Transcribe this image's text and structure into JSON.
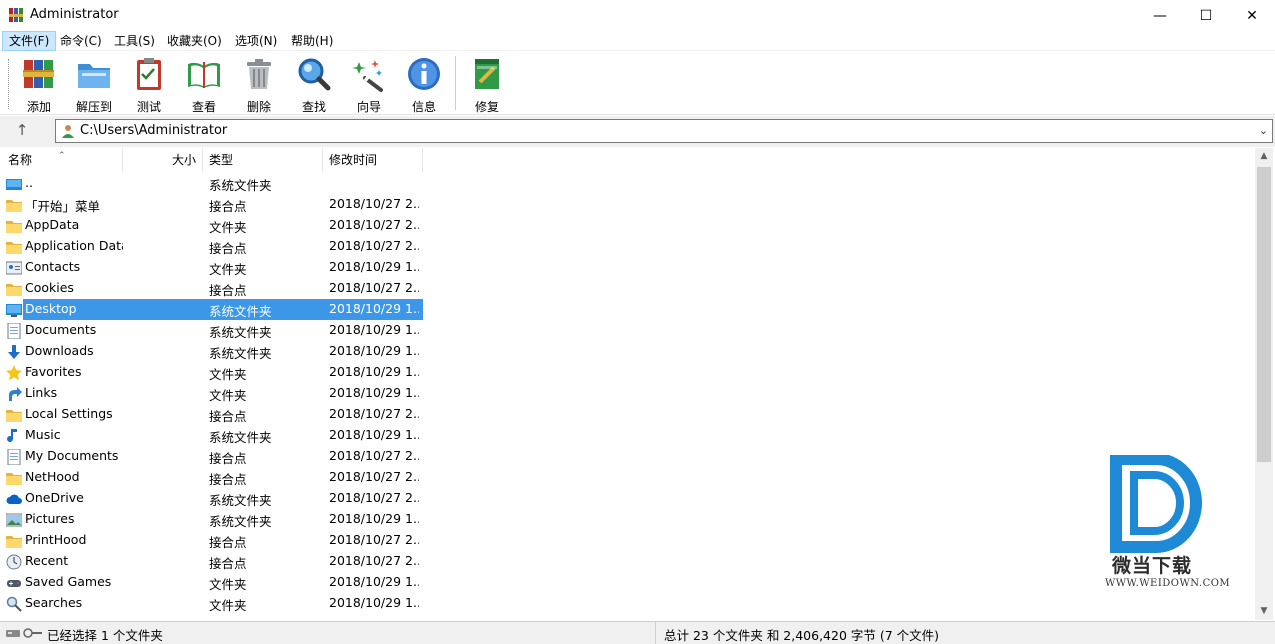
{
  "window": {
    "title": "Administrator",
    "min_glyph": "—",
    "max_glyph": "☐",
    "close_glyph": "✕"
  },
  "menu": [
    {
      "label": "文件(F)",
      "active": true
    },
    {
      "label": "命令(C)"
    },
    {
      "label": "工具(S)"
    },
    {
      "label": "收藏夹(O)"
    },
    {
      "label": "选项(N)"
    },
    {
      "label": "帮助(H)"
    }
  ],
  "toolbar": [
    {
      "label": "添加",
      "icon": "books-add-icon"
    },
    {
      "label": "解压到",
      "icon": "folder-extract-icon"
    },
    {
      "label": "测试",
      "icon": "clipboard-test-icon"
    },
    {
      "label": "查看",
      "icon": "open-book-view-icon"
    },
    {
      "label": "删除",
      "icon": "trash-icon"
    },
    {
      "label": "查找",
      "icon": "magnifier-icon"
    },
    {
      "label": "向导",
      "icon": "magic-wand-icon"
    },
    {
      "label": "信息",
      "icon": "info-icon"
    },
    {
      "label": "修复",
      "icon": "repair-kit-icon"
    }
  ],
  "address": {
    "up_glyph": "↑",
    "path": "C:\\Users\\Administrator",
    "drop_glyph": "⌄"
  },
  "columns": {
    "name": "名称",
    "size": "大小",
    "type": "类型",
    "mtime": "修改时间",
    "sort_glyph": "⌃"
  },
  "files": [
    {
      "name": "..",
      "type": "系统文件夹",
      "time": "",
      "icon": "drive-up-icon"
    },
    {
      "name": "「开始」菜单",
      "type": "接合点",
      "time": "2018/10/27 2...",
      "icon": "folder-icon"
    },
    {
      "name": "AppData",
      "type": "文件夹",
      "time": "2018/10/27 2...",
      "icon": "folder-icon"
    },
    {
      "name": "Application Data",
      "type": "接合点",
      "time": "2018/10/27 2...",
      "icon": "folder-icon"
    },
    {
      "name": "Contacts",
      "type": "文件夹",
      "time": "2018/10/29 1...",
      "icon": "contacts-icon"
    },
    {
      "name": "Cookies",
      "type": "接合点",
      "time": "2018/10/27 2...",
      "icon": "folder-icon"
    },
    {
      "name": "Desktop",
      "type": "系统文件夹",
      "time": "2018/10/29 1...",
      "icon": "desktop-icon",
      "selected": true
    },
    {
      "name": "Documents",
      "type": "系统文件夹",
      "time": "2018/10/29 1...",
      "icon": "documents-icon"
    },
    {
      "name": "Downloads",
      "type": "系统文件夹",
      "time": "2018/10/29 1...",
      "icon": "downloads-icon"
    },
    {
      "name": "Favorites",
      "type": "文件夹",
      "time": "2018/10/29 1...",
      "icon": "star-icon"
    },
    {
      "name": "Links",
      "type": "文件夹",
      "time": "2018/10/29 1...",
      "icon": "link-arrow-icon"
    },
    {
      "name": "Local Settings",
      "type": "接合点",
      "time": "2018/10/27 2...",
      "icon": "folder-icon"
    },
    {
      "name": "Music",
      "type": "系统文件夹",
      "time": "2018/10/29 1...",
      "icon": "music-note-icon"
    },
    {
      "name": "My Documents",
      "type": "接合点",
      "time": "2018/10/27 2...",
      "icon": "documents-icon"
    },
    {
      "name": "NetHood",
      "type": "接合点",
      "time": "2018/10/27 2...",
      "icon": "folder-icon"
    },
    {
      "name": "OneDrive",
      "type": "系统文件夹",
      "time": "2018/10/27 2...",
      "icon": "cloud-icon"
    },
    {
      "name": "Pictures",
      "type": "系统文件夹",
      "time": "2018/10/29 1...",
      "icon": "pictures-icon"
    },
    {
      "name": "PrintHood",
      "type": "接合点",
      "time": "2018/10/27 2...",
      "icon": "folder-icon"
    },
    {
      "name": "Recent",
      "type": "接合点",
      "time": "2018/10/27 2...",
      "icon": "recent-icon"
    },
    {
      "name": "Saved Games",
      "type": "文件夹",
      "time": "2018/10/29 1...",
      "icon": "games-icon"
    },
    {
      "name": "Searches",
      "type": "文件夹",
      "time": "2018/10/29 1...",
      "icon": "search-folder-icon"
    }
  ],
  "scroll": {
    "up_glyph": "▲",
    "down_glyph": "▼"
  },
  "status": {
    "left": "已经选择 1 个文件夹",
    "right": "总计 23 个文件夹 和 2,406,420 字节 (7 个文件)"
  },
  "watermark": {
    "text": "微当下载",
    "url": "WWW.WEIDOWN.COM"
  },
  "colors": {
    "selection": "#3d97e8",
    "folder": "#ffd86b",
    "accent_blue": "#1e8ad6"
  }
}
